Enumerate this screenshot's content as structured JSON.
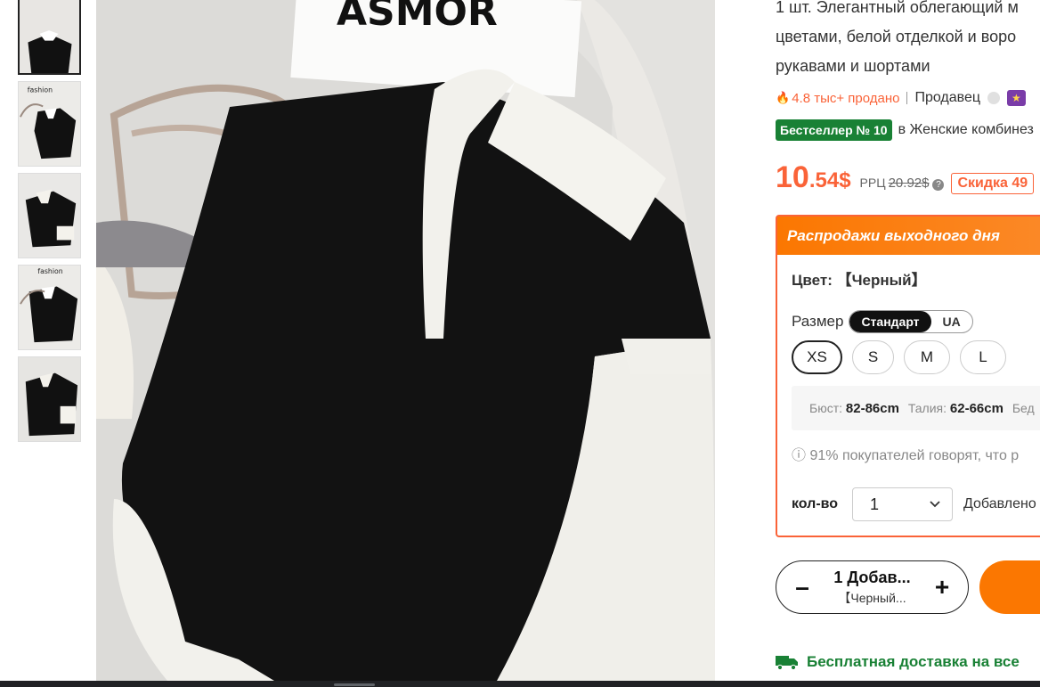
{
  "thumbnails": [
    {
      "label": "",
      "active": true
    },
    {
      "label": "fashion"
    },
    {
      "label": ""
    },
    {
      "label": "fashion"
    },
    {
      "label": ""
    }
  ],
  "main_image": {
    "box_text": "ASMOR"
  },
  "product": {
    "title_line1": "1 шт. Элегантный облегающий м",
    "title_line2": "цветами, белой отделкой и воро",
    "title_line3": "рукавами и шортами",
    "sold": "4.8 тыс+ продано",
    "seller_label": "Продавец",
    "best_badge": "Бестселлер № 10",
    "best_category": "в Женские комбинез",
    "price_int": "10",
    "price_dec": ".54$",
    "rrp_label": "РРЦ",
    "rrp_value": "20.92$",
    "discount": "Скидка 49"
  },
  "options": {
    "header": "Распродажи выходного дня",
    "color_label": "Цвет:",
    "color_value": "【Черный】",
    "size_label": "Размер",
    "size_systems": [
      "Стандарт",
      "UA"
    ],
    "sizes": [
      "XS",
      "S",
      "M",
      "L"
    ],
    "measure": {
      "bust_label": "Бюст:",
      "bust": "82-86cm",
      "waist_label": "Талия:",
      "waist": "62-66cm",
      "hip_label": "Бед"
    },
    "note": "91% покупателей говорят, что р",
    "qty_label": "кол-во",
    "qty_value": "1",
    "qty_note": "Добавлено"
  },
  "cart": {
    "line1": "1 Добав...",
    "line2": "【Черный..."
  },
  "shipping": {
    "text": "Бесплатная доставка на все"
  },
  "colors": {
    "accent": "#fb7701",
    "price": "#fa6338",
    "green": "#198135"
  }
}
